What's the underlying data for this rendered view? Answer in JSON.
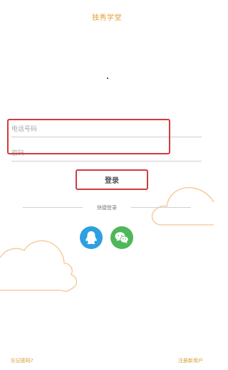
{
  "header": {
    "title": "独秀学堂"
  },
  "form": {
    "phone_placeholder": "电话号码",
    "password_placeholder": "密码",
    "login_label": "登录"
  },
  "quick_login": {
    "label": "快捷登录",
    "providers": [
      {
        "name": "qq",
        "icon": "qq-penguin-icon",
        "color": "#2e9fe1"
      },
      {
        "name": "wechat",
        "icon": "wechat-bubbles-icon",
        "color": "#4fb75b"
      }
    ]
  },
  "footer": {
    "forgot_password": "忘记密码?",
    "register": "注册新用户"
  },
  "colors": {
    "accent": "#e0a13c",
    "highlight": "#d33a3a",
    "cloud_outline": "#f6c592"
  }
}
